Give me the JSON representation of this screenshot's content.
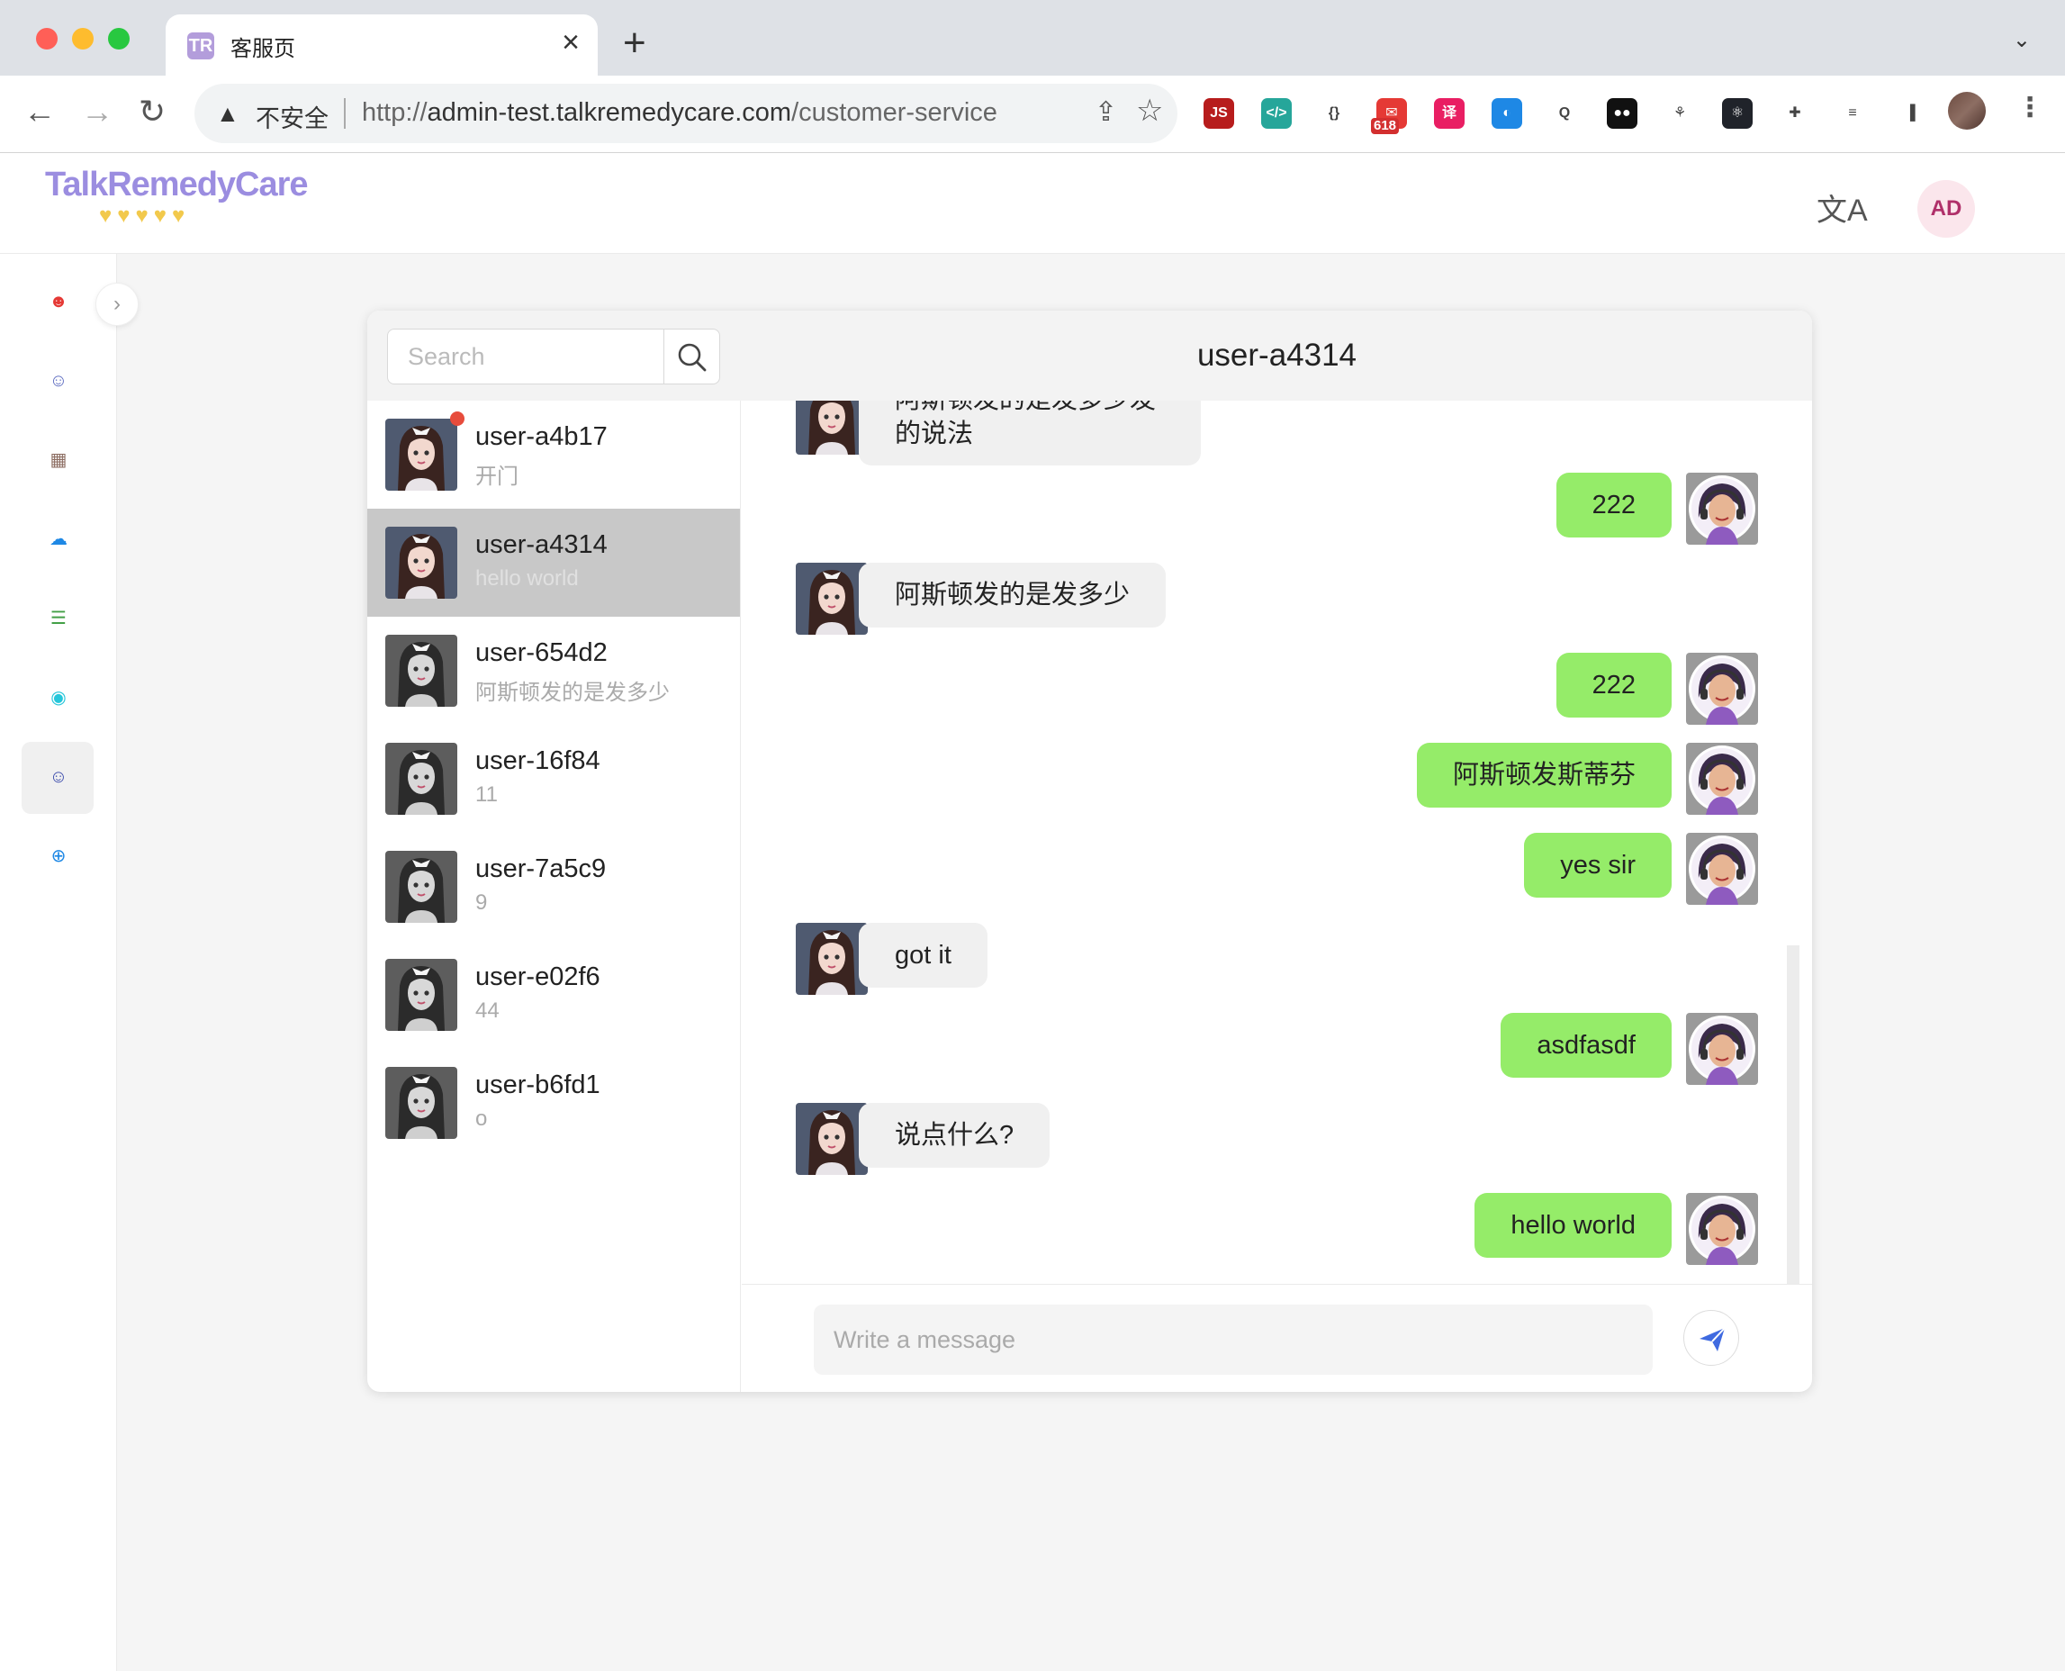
{
  "browser": {
    "tab_title": "客服页",
    "tab_favicon": "TR",
    "omnibox": {
      "security_label": "不安全",
      "url_prefix": "http://",
      "url_host": "admin-test.talkremedycare.com",
      "url_path": "/customer-service"
    },
    "extensions": [
      {
        "name": "js-extension-icon",
        "label": "JS",
        "color": "#b71c1c"
      },
      {
        "name": "code-extension-icon",
        "label": "</>",
        "color": "#26a69a"
      },
      {
        "name": "json-extension-icon",
        "label": "{}",
        "color": "#ffffff"
      },
      {
        "name": "mail-extension-icon",
        "label": "✉",
        "color": "#e53935",
        "badge": "618"
      },
      {
        "name": "translate-extension-icon",
        "label": "译",
        "color": "#e91e63"
      },
      {
        "name": "globe-extension-icon",
        "label": "◐",
        "color": "#1e88e5"
      },
      {
        "name": "search-extension-icon",
        "label": "Q",
        "color": "#ffffff"
      },
      {
        "name": "tampermonkey-extension-icon",
        "label": "●●",
        "color": "#111111"
      },
      {
        "name": "tree-extension-icon",
        "label": "⚘",
        "color": "#ffffff"
      },
      {
        "name": "react-extension-icon",
        "label": "⚛",
        "color": "#20232a"
      },
      {
        "name": "puzzle-extension-icon",
        "label": "✚",
        "color": "#ffffff"
      },
      {
        "name": "playlist-icon",
        "label": "≡",
        "color": "#ffffff"
      },
      {
        "name": "sidepanel-icon",
        "label": "▐",
        "color": "#ffffff"
      }
    ]
  },
  "app": {
    "logo": "TalkRemedyCare",
    "logo_hearts": "♥♥♥♥♥",
    "user_initials": "AD",
    "translate_icon": "文A"
  },
  "sidenav": {
    "items": [
      {
        "name": "nav-customer-service-icon",
        "glyph": "☻",
        "color": "#e53935"
      },
      {
        "name": "nav-user-icon",
        "glyph": "☺",
        "color": "#5c6bc0"
      },
      {
        "name": "nav-store-icon",
        "glyph": "▦",
        "color": "#8d6e63"
      },
      {
        "name": "nav-chat-icon",
        "glyph": "☁",
        "color": "#1e88e5"
      },
      {
        "name": "nav-list-icon",
        "glyph": "☰",
        "color": "#43a047"
      },
      {
        "name": "nav-rss-icon",
        "glyph": "◉",
        "color": "#26c6da"
      },
      {
        "name": "nav-agent-icon",
        "glyph": "☺",
        "color": "#3949ab",
        "active": true
      },
      {
        "name": "nav-lock-icon",
        "glyph": "⊕",
        "color": "#1e88e5"
      }
    ]
  },
  "search": {
    "placeholder": "Search"
  },
  "chat": {
    "title": "user-a4314",
    "input_placeholder": "Write a message"
  },
  "conversations": [
    {
      "name": "user-a4b17",
      "preview": "开门",
      "unread": true,
      "selected": false,
      "avatar_tone": "color"
    },
    {
      "name": "user-a4314",
      "preview": "hello world",
      "unread": false,
      "selected": true,
      "avatar_tone": "color"
    },
    {
      "name": "user-654d2",
      "preview": "阿斯顿发的是发多少",
      "unread": false,
      "selected": false,
      "avatar_tone": "gray"
    },
    {
      "name": "user-16f84",
      "preview": "11",
      "unread": false,
      "selected": false,
      "avatar_tone": "gray"
    },
    {
      "name": "user-7a5c9",
      "preview": "9",
      "unread": false,
      "selected": false,
      "avatar_tone": "gray"
    },
    {
      "name": "user-e02f6",
      "preview": "44",
      "unread": false,
      "selected": false,
      "avatar_tone": "gray"
    },
    {
      "name": "user-b6fd1",
      "preview": "o",
      "unread": false,
      "selected": false,
      "avatar_tone": "gray"
    }
  ],
  "messages": [
    {
      "from": "user",
      "text": "阿斯顿发的是发多少发的说法"
    },
    {
      "from": "agent",
      "text": "222"
    },
    {
      "from": "user",
      "text": "阿斯顿发的是发多少"
    },
    {
      "from": "agent",
      "text": "222"
    },
    {
      "from": "agent",
      "text": "阿斯顿发斯蒂芬"
    },
    {
      "from": "agent",
      "text": "yes sir"
    },
    {
      "from": "user",
      "text": "got it"
    },
    {
      "from": "agent",
      "text": "asdfasdf"
    },
    {
      "from": "user",
      "text": "说点什么?"
    },
    {
      "from": "agent",
      "text": "hello world"
    }
  ]
}
